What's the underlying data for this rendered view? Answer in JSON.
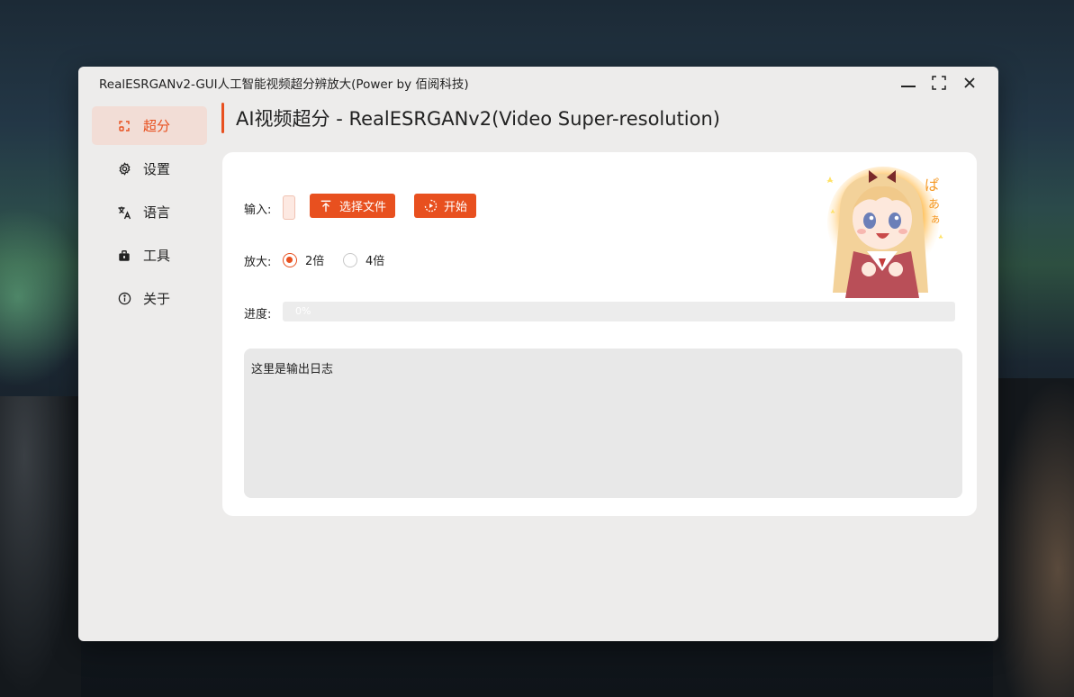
{
  "window": {
    "title": "RealESRGANv2-GUI人工智能视频超分辨放大(Power by 佰阅科技)"
  },
  "sidebar": {
    "items": [
      {
        "label": "超分",
        "icon": "upscale-icon",
        "active": true
      },
      {
        "label": "设置",
        "icon": "gear-icon",
        "active": false
      },
      {
        "label": "语言",
        "icon": "translate-icon",
        "active": false
      },
      {
        "label": "工具",
        "icon": "toolbox-icon",
        "active": false
      },
      {
        "label": "关于",
        "icon": "info-icon",
        "active": false
      }
    ]
  },
  "page": {
    "title": "AI视频超分 - RealESRGANv2(Video Super-resolution)"
  },
  "form": {
    "input_label": "输入:",
    "input_value": "",
    "select_file_label": "选择文件",
    "start_label": "开始",
    "scale_label": "放大:",
    "scale_options": [
      {
        "label": "2倍",
        "checked": true
      },
      {
        "label": "4倍",
        "checked": false
      }
    ],
    "progress_label": "进度:",
    "progress_text": "0%",
    "progress_value": 0,
    "log_text": "这里是输出日志"
  },
  "colors": {
    "accent": "#e8501f",
    "active_nav_bg": "#f2ddd6",
    "window_bg": "#edeceb",
    "card_bg": "#ffffff",
    "log_bg": "#e8e8e8"
  }
}
